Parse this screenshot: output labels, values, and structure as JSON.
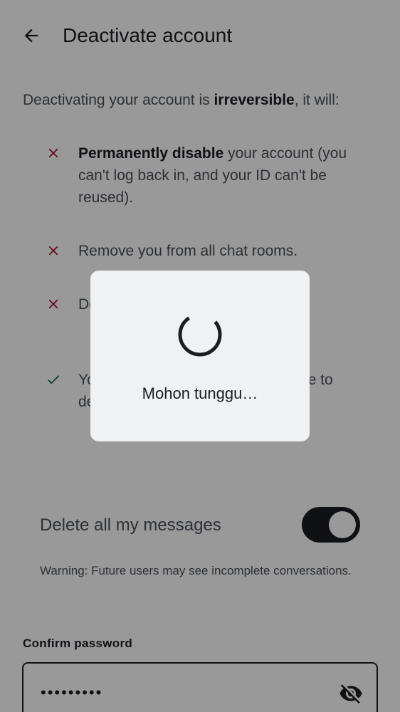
{
  "header": {
    "title": "Deactivate account",
    "back_icon": "arrow-left-icon"
  },
  "intro": {
    "prefix": "Deactivating your account is ",
    "bold": "irreversible",
    "suffix": ", it will:"
  },
  "items": [
    {
      "icon": "cross-icon",
      "bold": "Permanently disable",
      "text": " your account (you can't log back in, and your ID can't be reused)."
    },
    {
      "icon": "cross-icon",
      "bold": "",
      "text": "Remove you from all chat rooms."
    },
    {
      "icon": "cross-icon",
      "bold": "",
      "text": "De... from ou..."
    },
    {
      "icon": "check-icon",
      "bold": "",
      "text": "Yo... e to re... ailable to... ou choose to delete them."
    }
  ],
  "toggle": {
    "label": "Delete all my messages",
    "state": "on"
  },
  "warning": "Warning: Future users may see incomplete conversations.",
  "password": {
    "label": "Confirm password",
    "value": "•••••••••",
    "visibility_icon": "eye-off-icon"
  },
  "dialog": {
    "message": "Mohon tunggu…"
  },
  "colors": {
    "cross": "#b3132a",
    "check": "#0c6b4e",
    "scrim": "rgba(0,0,0,0.40)",
    "dialog_bg": "#eff1f5"
  }
}
